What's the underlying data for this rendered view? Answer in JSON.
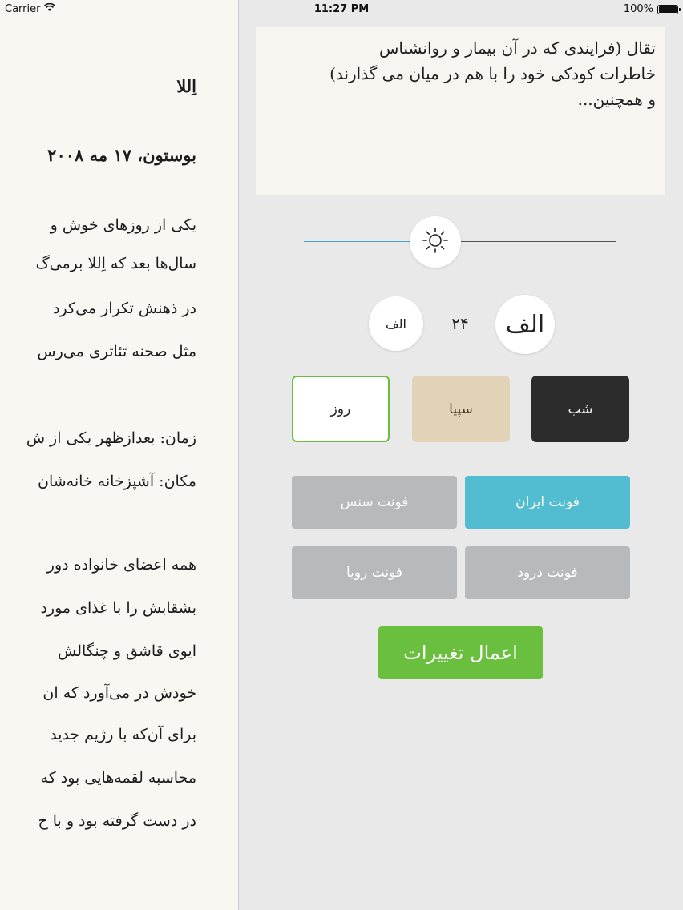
{
  "status_bar": {
    "carrier": "Carrier",
    "wifi_icon": "wifi-icon",
    "time": "11:27 PM",
    "battery_text": "100%",
    "battery_level": 1.0
  },
  "reader": {
    "title": "اِللا",
    "date_line": "بوستون، ۱۷ مه ۲۰۰۸",
    "paragraph1": [
      "یکی از روزهای خوش و",
      "سال‌ها بعد که اِللا برمی‌گ",
      "در ذهنش تکرار می‌کرد",
      "مثل صحنه تئاتری می‌رس"
    ],
    "paragraph2": [
      "زمان: بعدازظهر یکی از ش",
      "مکان: آشپزخانه خانه‌شان"
    ],
    "paragraph3": [
      "همه اعضای خانواده دور",
      "بشقابش را با غذای مورد",
      "ایوی قاشق و چنگالش",
      "خودش در می‌آورد که ان",
      "برای آن‌که با رژیم جدید",
      "محاسبه لقمه‌هایی بود که",
      "در دست گرفته بود و با ح"
    ]
  },
  "panel": {
    "preview_lines": [
      "تقال (فرایندی که در آن بیمار و روانشناس",
      "خاطرات کودکی خود را با هم در میان می گذارند)",
      "و همچنین..."
    ],
    "brightness": {
      "icon": "sun-icon",
      "level": 0.42,
      "track_color_active": "#4aa3d8"
    },
    "font_size": {
      "decrease_label": "الف",
      "increase_label": "الف",
      "value": "۲۴"
    },
    "themes": {
      "day": "روز",
      "sepia": "سپیا",
      "night": "شب",
      "selected": "day"
    },
    "fonts": {
      "sans": "فونت سنس",
      "iran": "فونت ایران",
      "roya": "فونت رویا",
      "darud": "فونت درود",
      "selected": "iran",
      "selected_color": "#52bcd0"
    },
    "apply_label": "اعمال تغییرات",
    "apply_color": "#6abf3f"
  }
}
